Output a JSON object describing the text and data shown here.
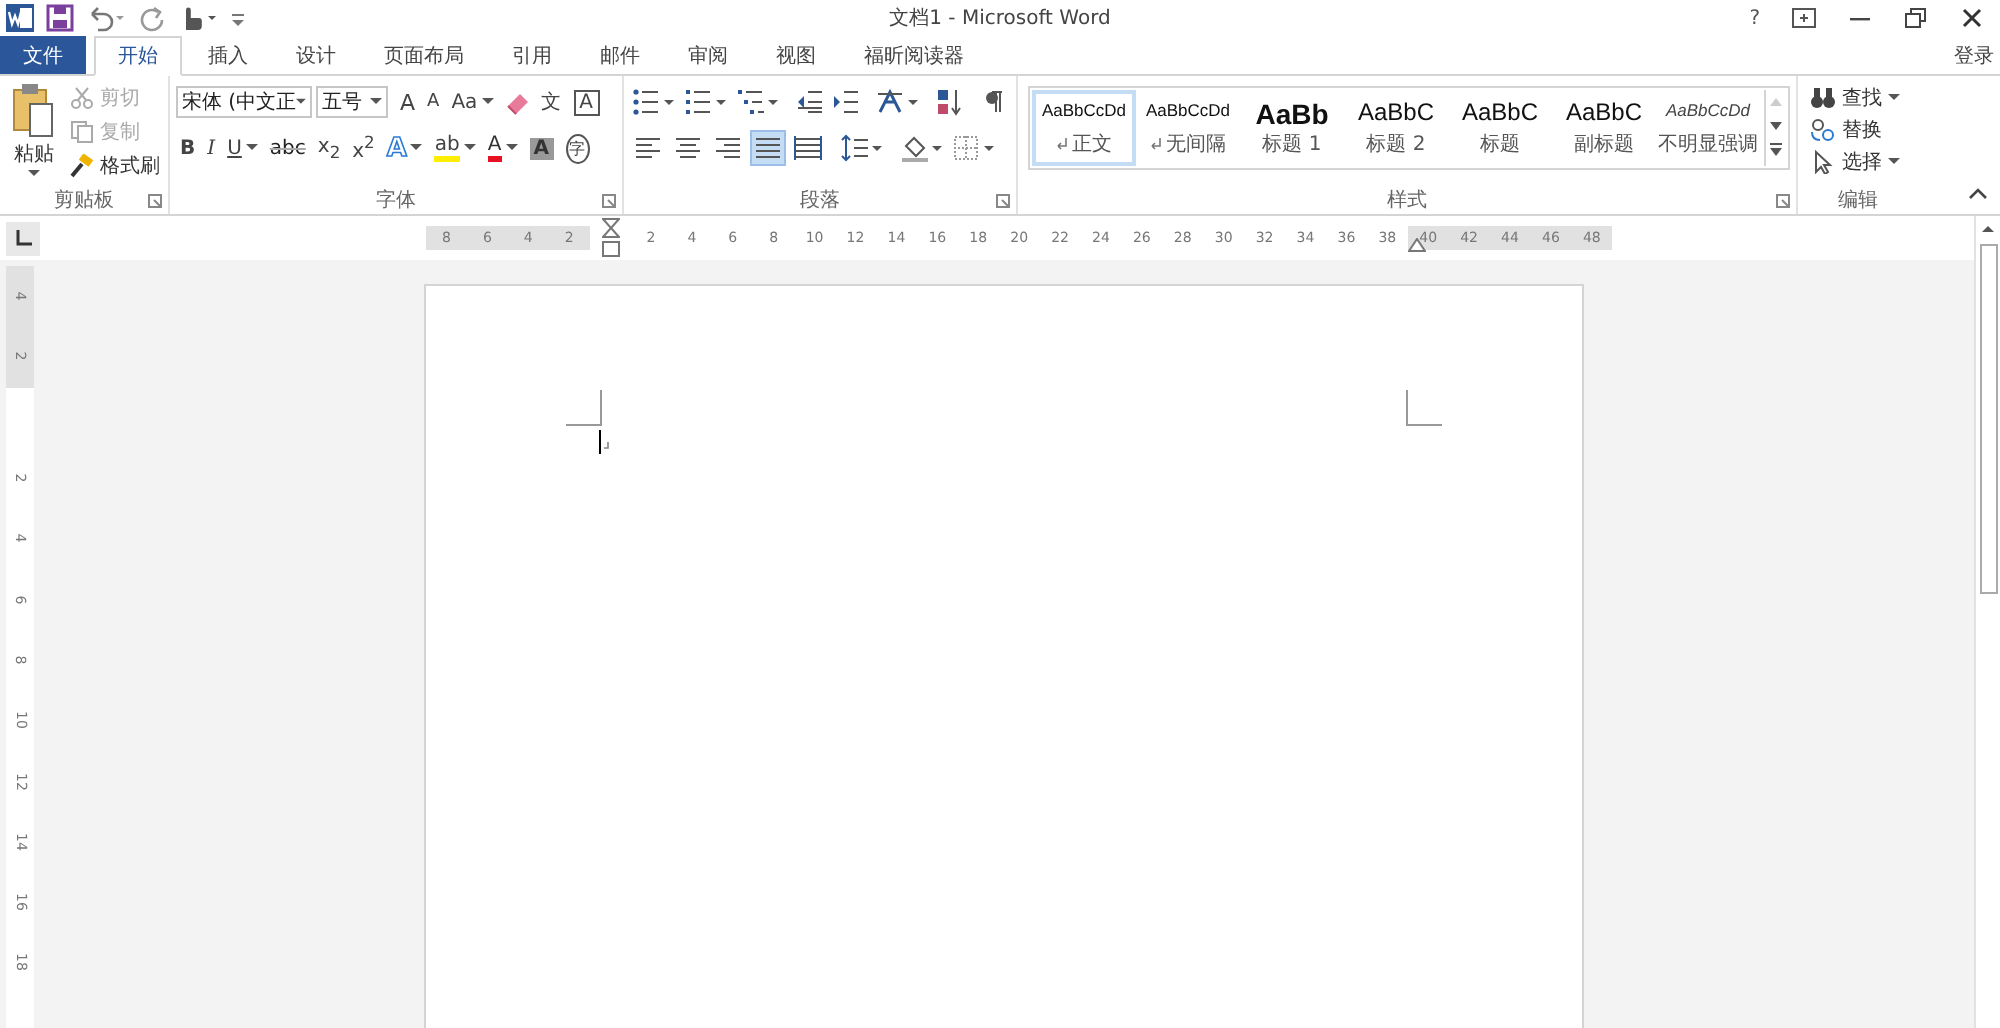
{
  "title_bar": {
    "title": "文档1 - Microsoft Word",
    "help": "?"
  },
  "tabs": [
    {
      "label": "文件",
      "kind": "file",
      "selected": false
    },
    {
      "label": "开始",
      "kind": "tab",
      "selected": true
    },
    {
      "label": "插入",
      "kind": "tab",
      "selected": false
    },
    {
      "label": "设计",
      "kind": "tab",
      "selected": false
    },
    {
      "label": "页面布局",
      "kind": "tab",
      "selected": false
    },
    {
      "label": "引用",
      "kind": "tab",
      "selected": false
    },
    {
      "label": "邮件",
      "kind": "tab",
      "selected": false
    },
    {
      "label": "审阅",
      "kind": "tab",
      "selected": false
    },
    {
      "label": "视图",
      "kind": "tab",
      "selected": false
    },
    {
      "label": "福昕阅读器",
      "kind": "tab",
      "selected": false
    }
  ],
  "sign_in": "登录",
  "clipboard": {
    "label": "剪贴板",
    "paste": "粘贴",
    "items": [
      {
        "kind": "cut",
        "label": "剪切",
        "disabled": true
      },
      {
        "kind": "copy",
        "label": "复制",
        "disabled": true
      },
      {
        "kind": "painter",
        "label": "格式刷",
        "disabled": false
      }
    ]
  },
  "font": {
    "label": "字体",
    "name": "宋体 (中文正",
    "size": "五号",
    "row1": [
      {
        "kind": "grow",
        "text": "A",
        "dropdown": false
      },
      {
        "kind": "shrink",
        "text": "A",
        "dropdown": false
      },
      {
        "kind": "case",
        "text": "Aa",
        "dropdown": true
      }
    ],
    "row1b": [
      {
        "kind": "phonetic",
        "text": "文",
        "dropdown": false
      },
      {
        "kind": "boxed",
        "text": "A",
        "dropdown": false
      }
    ],
    "row2": [
      {
        "kind": "bold",
        "text": "B",
        "dropdown": false
      },
      {
        "kind": "italic",
        "text": "I",
        "dropdown": false
      },
      {
        "kind": "underline",
        "text": "U",
        "dropdown": true
      },
      {
        "kind": "strike",
        "text": "abc",
        "dropdown": false
      },
      {
        "kind": "plain",
        "text": "x$_{2}$",
        "dropdown": false
      },
      {
        "kind": "plain",
        "text": "x$^{2}$",
        "dropdown": false
      },
      {
        "kind": "effect",
        "text": "A",
        "dropdown": true
      },
      {
        "kind": "highlight",
        "text": "ab",
        "dropdown": true
      },
      {
        "kind": "color",
        "text": "A",
        "dropdown": true
      },
      {
        "kind": "shade",
        "text": "A",
        "dropdown": false
      },
      {
        "kind": "enclose",
        "text": "字",
        "dropdown": false
      }
    ]
  },
  "paragraph": {
    "label": "段落",
    "alignments": [
      {
        "kind": "left",
        "selected": false
      },
      {
        "kind": "center",
        "selected": false
      },
      {
        "kind": "right",
        "selected": false
      },
      {
        "kind": "justify",
        "selected": true
      },
      {
        "kind": "distribute",
        "selected": false
      }
    ]
  },
  "styles": {
    "label": "样式",
    "items": [
      {
        "preview": "AaBbCcDd",
        "name": "正文",
        "kind": "small",
        "mark": true,
        "selected": true
      },
      {
        "preview": "AaBbCcDd",
        "name": "无间隔",
        "kind": "small",
        "mark": true,
        "selected": false
      },
      {
        "preview": "AaBb",
        "name": "标题 1",
        "kind": "heavy",
        "mark": false,
        "selected": false
      },
      {
        "preview": "AaBbC",
        "name": "标题 2",
        "kind": "large",
        "mark": false,
        "selected": false
      },
      {
        "preview": "AaBbC",
        "name": "标题",
        "kind": "large",
        "mark": false,
        "selected": false
      },
      {
        "preview": "AaBbC",
        "name": "副标题",
        "kind": "large",
        "mark": false,
        "selected": false
      },
      {
        "preview": "AaBbCcDd",
        "name": "不明显强调",
        "kind": "italic",
        "mark": false,
        "selected": false
      }
    ]
  },
  "editing": {
    "label": "编辑",
    "items": [
      {
        "kind": "find",
        "label": "查找",
        "dropdown": true
      },
      {
        "kind": "replace",
        "label": "替换",
        "dropdown": false
      },
      {
        "kind": "select",
        "label": "选择",
        "dropdown": true
      }
    ]
  },
  "ruler": {
    "left": [
      {
        "label": "8",
        "margin": true
      },
      {
        "label": "6",
        "margin": true
      },
      {
        "label": "4",
        "margin": true
      },
      {
        "label": "2",
        "margin": true
      }
    ],
    "right": [
      {
        "label": "2",
        "margin": false
      },
      {
        "label": "4",
        "margin": false
      },
      {
        "label": "6",
        "margin": false
      },
      {
        "label": "8",
        "margin": false
      },
      {
        "label": "10",
        "margin": false
      },
      {
        "label": "12",
        "margin": false
      },
      {
        "label": "14",
        "margin": false
      },
      {
        "label": "16",
        "margin": false
      },
      {
        "label": "18",
        "margin": false
      },
      {
        "label": "20",
        "margin": false
      },
      {
        "label": "22",
        "margin": false
      },
      {
        "label": "24",
        "margin": false
      },
      {
        "label": "26",
        "margin": false
      },
      {
        "label": "28",
        "margin": false
      },
      {
        "label": "30",
        "margin": false
      },
      {
        "label": "32",
        "margin": false
      },
      {
        "label": "34",
        "margin": false
      },
      {
        "label": "36",
        "margin": false
      },
      {
        "label": "38",
        "margin": false
      },
      {
        "label": "40",
        "margin": true
      },
      {
        "label": "42",
        "margin": true
      },
      {
        "label": "44",
        "margin": true
      },
      {
        "label": "46",
        "margin": true
      },
      {
        "label": "48",
        "margin": true
      }
    ]
  },
  "vertical_ruler": {
    "top": [
      {
        "label": "4",
        "margin": true
      },
      {
        "label": "2",
        "margin": true
      }
    ],
    "body": [
      {
        "label": "2",
        "margin": false
      },
      {
        "label": "4",
        "margin": false
      },
      {
        "label": "6",
        "margin": false
      },
      {
        "label": "8",
        "margin": false
      },
      {
        "label": "10",
        "margin": false
      },
      {
        "label": "12",
        "margin": false
      },
      {
        "label": "14",
        "margin": false
      },
      {
        "label": "16",
        "margin": false
      },
      {
        "label": "18",
        "margin": false
      }
    ]
  }
}
